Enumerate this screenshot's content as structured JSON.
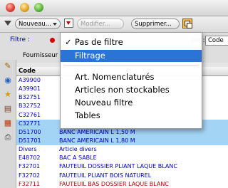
{
  "toolbar": {
    "nouveau": "Nouveau...",
    "modifier": "Modifier...",
    "supprimer": "Supprimer..."
  },
  "filter": {
    "label": "Filtre :",
    "par_label": "par :",
    "par_value": "Code",
    "fournisseur_label": "Fournisseur"
  },
  "menu": {
    "items": [
      {
        "label": "Pas de filtre",
        "checked": true
      },
      {
        "label": "Filtrage",
        "highlighted": true
      },
      {
        "label": "Art. Nomenclaturés"
      },
      {
        "label": "Articles non stockables"
      },
      {
        "label": "Nouveau filtre"
      },
      {
        "label": "Tables"
      }
    ]
  },
  "table": {
    "header": "Code",
    "rows": [
      {
        "code": "A39900",
        "label": "",
        "color": "#0000c8",
        "selected": false
      },
      {
        "code": "A39901",
        "label": "",
        "color": "#0000c8",
        "selected": false
      },
      {
        "code": "B32751",
        "label": "",
        "color": "#0000c8",
        "selected": false
      },
      {
        "code": "B32752",
        "label": "",
        "color": "#0000c8",
        "selected": false
      },
      {
        "code": "C32761",
        "label": "",
        "color": "#0000c8",
        "selected": false
      },
      {
        "code": "C32771",
        "label": "",
        "color": "#0000c8",
        "selected": true
      },
      {
        "code": "D51700",
        "label": "BANC AMERICAIN L 1,50 M",
        "color": "#0000c8",
        "selected": true
      },
      {
        "code": "D51701",
        "label": "BANC AMERICAIN L 1,80 M",
        "color": "#0000c8",
        "selected": true
      },
      {
        "code": "Divers",
        "label": "Article divers",
        "color": "#0000c8",
        "selected": false
      },
      {
        "code": "E48702",
        "label": "BAC A SABLE",
        "color": "#0000c8",
        "selected": false
      },
      {
        "code": "F32701",
        "label": "FAUTEUIL DOSSIER PLIANT LAQUE BLANC",
        "color": "#0000c8",
        "selected": false
      },
      {
        "code": "F32702",
        "label": "FAUTEUIL PLIANT BOIS NATUREL",
        "color": "#0000c8",
        "selected": false
      },
      {
        "code": "F32711",
        "label": "FAUTEUIL BAS DOSSIER LAQUE BLANC",
        "color": "#c80000",
        "selected": false
      }
    ]
  },
  "icons": [
    "pencil-icon",
    "globe-icon",
    "star-icon",
    "books-icon",
    "calendar-icon",
    "printer-icon"
  ]
}
